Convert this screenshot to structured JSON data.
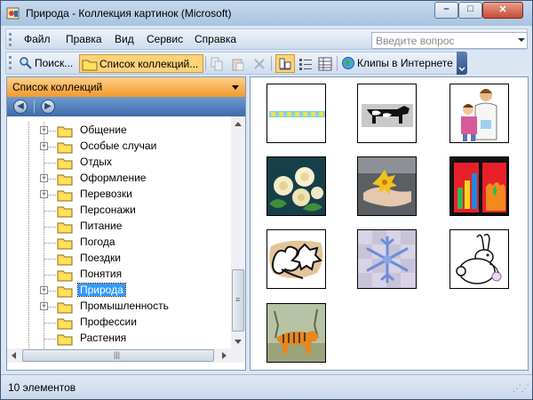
{
  "window": {
    "title": "Природа - Коллекция картинок (Microsoft)",
    "controls": {
      "minimize": "–",
      "maximize": "□",
      "close": "✕"
    }
  },
  "menubar": {
    "items": [
      "Файл",
      "Правка",
      "Вид",
      "Сервис",
      "Справка"
    ],
    "ask_placeholder": "Введите вопрос"
  },
  "toolbar": {
    "search_label": "Поиск...",
    "collections_label": "Список коллекций...",
    "clips_online_label": "Клипы в Интернете"
  },
  "collections_pane": {
    "title": "Список коллекций",
    "items": [
      {
        "label": "Общение",
        "expandable": true,
        "selected": false
      },
      {
        "label": "Особые случаи",
        "expandable": true,
        "selected": false
      },
      {
        "label": "Отдых",
        "expandable": false,
        "selected": false
      },
      {
        "label": "Оформление",
        "expandable": true,
        "selected": false
      },
      {
        "label": "Перевозки",
        "expandable": true,
        "selected": false
      },
      {
        "label": "Персонажи",
        "expandable": false,
        "selected": false
      },
      {
        "label": "Питание",
        "expandable": false,
        "selected": false
      },
      {
        "label": "Погода",
        "expandable": false,
        "selected": false
      },
      {
        "label": "Поездки",
        "expandable": false,
        "selected": false
      },
      {
        "label": "Понятия",
        "expandable": false,
        "selected": false
      },
      {
        "label": "Природа",
        "expandable": true,
        "selected": true
      },
      {
        "label": "Промышленность",
        "expandable": true,
        "selected": false
      },
      {
        "label": "Профессии",
        "expandable": false,
        "selected": false
      },
      {
        "label": "Растения",
        "expandable": false,
        "selected": false
      }
    ]
  },
  "clips": [
    {
      "name": "border-clip"
    },
    {
      "name": "cow-clip"
    },
    {
      "name": "doctor-child-clip"
    },
    {
      "name": "roses-clip"
    },
    {
      "name": "hand-flower-clip"
    },
    {
      "name": "abstract-chart-clip"
    },
    {
      "name": "leaves-clip"
    },
    {
      "name": "snowflake-clip"
    },
    {
      "name": "rabbit-clip"
    },
    {
      "name": "tiger-clip"
    }
  ],
  "status": {
    "text": "10 элементов"
  },
  "colors": {
    "accent_orange": "#f29a2c",
    "selection": "#3399ff",
    "nav_blue": "#3d6bab"
  }
}
